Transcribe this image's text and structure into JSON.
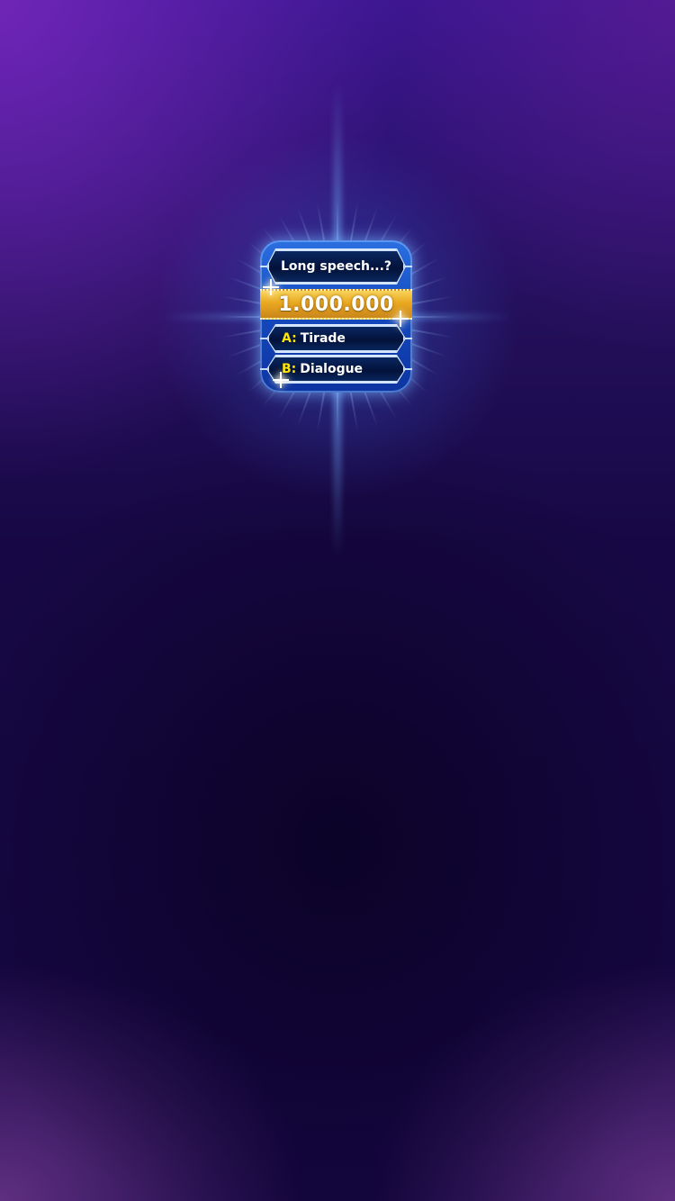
{
  "game": {
    "question": "Long speech...?",
    "prize": "1.000.000",
    "answers": [
      {
        "letter": "A:",
        "text": "Tirade"
      },
      {
        "letter": "B:",
        "text": "Dialogue"
      }
    ]
  },
  "icons": {
    "sparkle": "sparkle-icon"
  },
  "colors": {
    "background": "#140640",
    "card_blue": "#1448bd",
    "prize_gold": "#e9a820",
    "answer_letter": "#ffe600",
    "glow": "#5096ff"
  }
}
